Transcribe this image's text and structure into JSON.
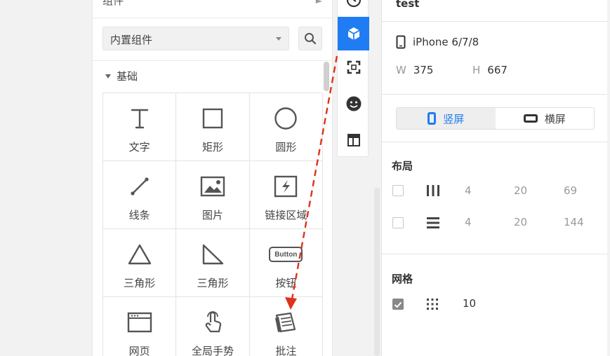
{
  "panel": {
    "header_label": "组件",
    "library_select": "内置组件",
    "section": "基础",
    "components": [
      {
        "label": "文字",
        "icon": "text-icon"
      },
      {
        "label": "矩形",
        "icon": "rectangle-icon"
      },
      {
        "label": "圆形",
        "icon": "circle-icon"
      },
      {
        "label": "线条",
        "icon": "line-icon"
      },
      {
        "label": "图片",
        "icon": "image-icon"
      },
      {
        "label": "链接区域",
        "icon": "link-area-icon"
      },
      {
        "label": "三角形",
        "icon": "triangle-icon"
      },
      {
        "label": "三角形",
        "icon": "right-triangle-icon"
      },
      {
        "label": "按钮",
        "icon": "button-icon",
        "icon_text": "Button"
      },
      {
        "label": "网页",
        "icon": "webpage-icon"
      },
      {
        "label": "全局手势",
        "icon": "gesture-icon"
      },
      {
        "label": "批注",
        "icon": "annotation-icon"
      }
    ]
  },
  "toolbar": {
    "items": [
      "history-icon",
      "component-cube-icon",
      "artboard-icon",
      "emoji-icon",
      "layout-icon"
    ],
    "active_index": 1
  },
  "properties": {
    "title": "test",
    "device": "iPhone 6/7/8",
    "width_label": "W",
    "width": "375",
    "height_label": "H",
    "height": "667",
    "orientation": {
      "portrait": "竖屏",
      "landscape": "横屏",
      "selected": "portrait"
    },
    "layout": {
      "label": "布局",
      "columns": {
        "checked": false,
        "values": [
          "4",
          "20",
          "69"
        ]
      },
      "rows": {
        "checked": false,
        "values": [
          "4",
          "20",
          "144"
        ]
      }
    },
    "grid": {
      "label": "网格",
      "checked": true,
      "value": "10"
    }
  },
  "colors": {
    "accent": "#1f7cf2",
    "arrow": "#e0321c"
  }
}
